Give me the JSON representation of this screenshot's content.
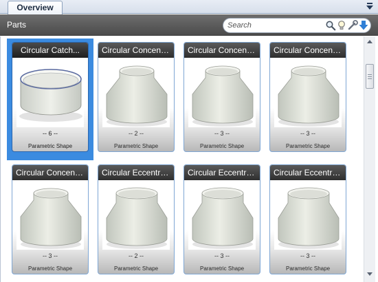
{
  "tabs": [
    {
      "label": "Overview",
      "active": true
    }
  ],
  "header": {
    "title": "Parts"
  },
  "search": {
    "placeholder": "Search",
    "value": "",
    "icons": [
      "magnifier-icon",
      "lightbulb-icon",
      "wrench-icon",
      "download-arrow-icon"
    ]
  },
  "colors": {
    "selection": "#3b8be0",
    "header": "#5a5a5a",
    "card_border": "#7ea6d4"
  },
  "parts": [
    {
      "name": "Circular Catch...",
      "count": "-- 6 --",
      "type": "Parametric Shape",
      "shape": "catch-ring",
      "selected": true
    },
    {
      "name": "Circular Concentric...",
      "count": "-- 2 --",
      "type": "Parametric Shape",
      "shape": "concentric",
      "selected": false
    },
    {
      "name": "Circular Concentric...",
      "count": "-- 3 --",
      "type": "Parametric Shape",
      "shape": "concentric",
      "selected": false
    },
    {
      "name": "Circular Concentric...",
      "count": "-- 3 --",
      "type": "Parametric Shape",
      "shape": "concentric",
      "selected": false
    },
    {
      "name": "Circular Concentric...",
      "count": "-- 3 --",
      "type": "Parametric Shape",
      "shape": "concentric",
      "selected": false
    },
    {
      "name": "Circular Eccentric...",
      "count": "-- 2 --",
      "type": "Parametric Shape",
      "shape": "eccentric",
      "selected": false
    },
    {
      "name": "Circular Eccentric...",
      "count": "-- 3 --",
      "type": "Parametric Shape",
      "shape": "eccentric",
      "selected": false
    },
    {
      "name": "Circular Eccentric...",
      "count": "-- 3 --",
      "type": "Parametric Shape",
      "shape": "eccentric",
      "selected": false
    }
  ]
}
